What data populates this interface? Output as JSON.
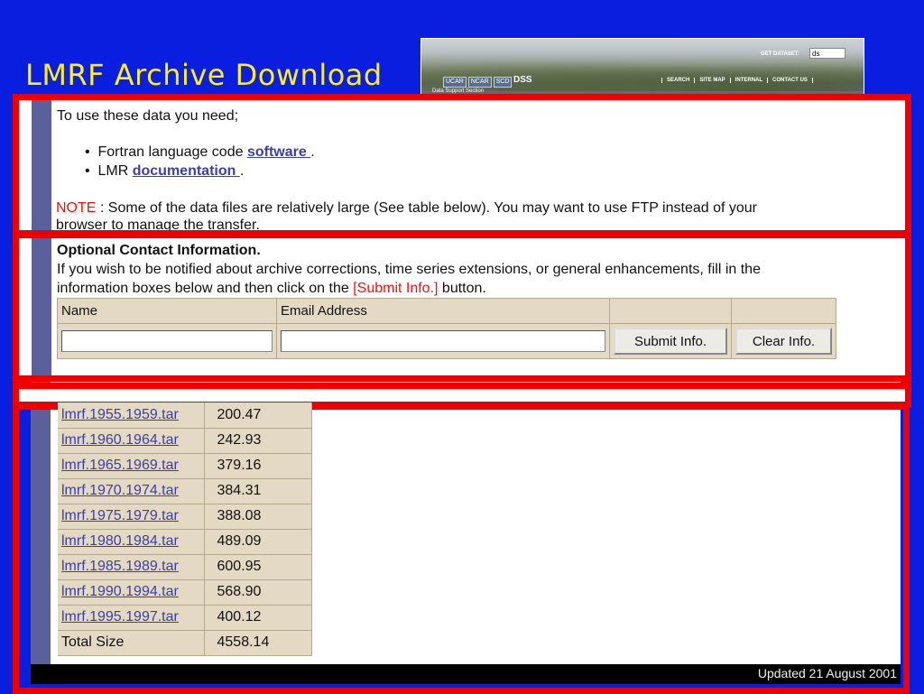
{
  "slide": {
    "title": "LMRF Archive Download"
  },
  "banner": {
    "get_dataset_label": "GET DATASET:",
    "get_dataset_value": "ds",
    "org_tabs": [
      "UCAR",
      "NCAR",
      "SCD"
    ],
    "section_name": "DSS",
    "section_subtitle": "Data Support Section",
    "links": [
      "SEARCH",
      "SITE MAP",
      "INTERNAL",
      "CONTACT US"
    ]
  },
  "intro": {
    "lead": "To use these data you need;",
    "items": [
      {
        "prefix": "Fortran language code ",
        "link": "software ",
        "suffix": "."
      },
      {
        "prefix": "LMR ",
        "link": "documentation ",
        "suffix": "."
      }
    ],
    "note_label": "NOTE",
    "note_text": " : Some of the data files are relatively large (See table below). You may want to use FTP instead of your",
    "note_text_2": "browser to manage the transfer."
  },
  "contact": {
    "heading": "Optional Contact Information.",
    "line1": "If you wish to be notified about archive corrections, time series extensions, or general enhancements, fill in the",
    "line2_prefix": "information boxes below and then click on the ",
    "line2_highlight": "[Submit Info.]",
    "line2_suffix": " button.",
    "name_header": "Name",
    "email_header": "Email Address",
    "name_value": "",
    "email_value": "",
    "submit_label": "Submit Info.",
    "clear_label": "Clear Info."
  },
  "files": {
    "rows": [
      {
        "name": "lmrf.1955.1959.tar ",
        "size": "200.47"
      },
      {
        "name": "lmrf.1960.1964.tar ",
        "size": "242.93"
      },
      {
        "name": "lmrf.1965.1969.tar ",
        "size": "379.16"
      },
      {
        "name": "lmrf.1970.1974.tar ",
        "size": "384.31"
      },
      {
        "name": "lmrf.1975.1979.tar ",
        "size": "388.08"
      },
      {
        "name": "lmrf.1980.1984.tar ",
        "size": "489.09"
      },
      {
        "name": "lmrf.1985.1989.tar ",
        "size": "600.95"
      },
      {
        "name": "lmrf.1990.1994.tar ",
        "size": "568.90"
      },
      {
        "name": "lmrf.1995.1997.tar ",
        "size": "400.12"
      }
    ],
    "total_label": "Total Size",
    "total_value": "4558.14"
  },
  "footer": {
    "updated": "Updated 21 August 2001"
  },
  "colors": {
    "slide_background": "#0a1ee0",
    "slide_title": "#ffee22",
    "callout_frame": "#ee0000",
    "table_fill": "#e4d9c4",
    "link": "#3b3fa8"
  }
}
